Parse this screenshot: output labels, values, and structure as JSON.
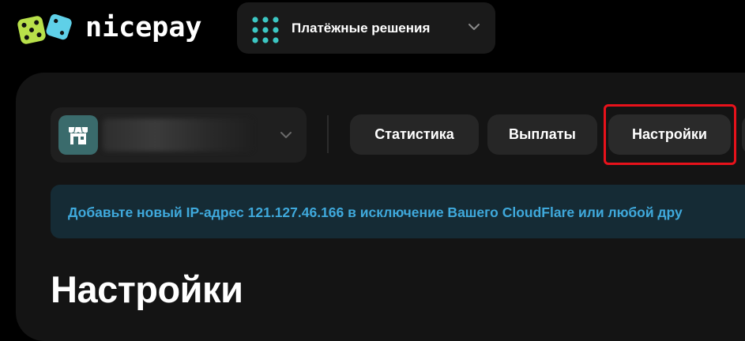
{
  "header": {
    "brand": "nicepay",
    "solutions_label": "Платёжные решения",
    "logo_icon": "dice-logo-icon",
    "solutions_icon": "dots-grid-icon",
    "chevron_icon": "chevron-down-icon"
  },
  "merchant": {
    "icon": "shop-icon",
    "name_redacted": true,
    "chevron_icon": "chevron-down-icon"
  },
  "tabs": [
    {
      "label": "Статистика",
      "active": false
    },
    {
      "label": "Выплаты",
      "active": false
    },
    {
      "label": "Настройки",
      "active": true
    }
  ],
  "notice": {
    "text": "Добавьте новый IP-адрес 121.127.46.166 в исключение Вашего CloudFlare или любой дру"
  },
  "page": {
    "title": "Настройки"
  },
  "colors": {
    "background": "#000000",
    "panel": "#141414",
    "button": "#262626",
    "accent_teal": "#3cc7c3",
    "notice_bg": "#152b35",
    "notice_text": "#3fa9dc",
    "highlight": "#e8121b",
    "logo_green": "#b8e04a",
    "logo_blue": "#5fd0e8"
  }
}
